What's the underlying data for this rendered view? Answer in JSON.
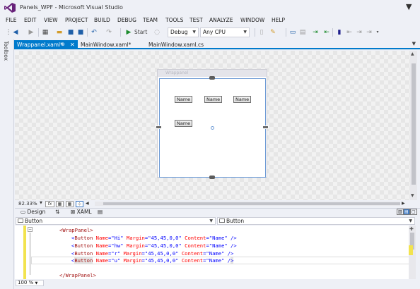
{
  "window": {
    "title": "Panels_WPF - Microsoft Visual Studio",
    "filter_icon": "funnel-icon",
    "logo_color": "#68217a"
  },
  "menu": [
    {
      "label": "FILE"
    },
    {
      "label": "EDIT"
    },
    {
      "label": "VIEW"
    },
    {
      "label": "PROJECT"
    },
    {
      "label": "BUILD"
    },
    {
      "label": "DEBUG"
    },
    {
      "label": "TEAM"
    },
    {
      "label": "TOOLS"
    },
    {
      "label": "TEST"
    },
    {
      "label": "ANALYZE"
    },
    {
      "label": "WINDOW"
    },
    {
      "label": "HELP"
    }
  ],
  "toolbar": {
    "start_label": "Start",
    "configuration": "Debug",
    "platform": "Any CPU",
    "start_color": "#1e8c2e"
  },
  "toolbox": {
    "label": "Toolbox"
  },
  "tabs": [
    {
      "label": "Wrappanel.xaml*",
      "active": true
    },
    {
      "label": "MainWindow.xaml*",
      "active": false
    },
    {
      "label": "MainWindow.xaml.cs",
      "active": false
    }
  ],
  "designer": {
    "window_caption": "Wrappanel",
    "buttons": [
      {
        "label": "Name"
      },
      {
        "label": "Name"
      },
      {
        "label": "Name"
      },
      {
        "label": "Name"
      }
    ]
  },
  "zoom_bar": {
    "zoom": "82.33%",
    "fx_label": "fx"
  },
  "split_tabs": {
    "design": "Design",
    "swap": "⇅",
    "xaml": "XAML"
  },
  "nav": {
    "left": "Button",
    "right": "Button"
  },
  "code": {
    "open_tag": "<WrapPanel>",
    "close_tag": "</WrapPanel>",
    "lines": [
      {
        "el": "Button",
        "name": "Hi"
      },
      {
        "el": "Button",
        "name": "hw"
      },
      {
        "el": "Button",
        "name": "r"
      },
      {
        "el": "Button",
        "name": "u"
      }
    ],
    "margin": "45,45,0,0",
    "content": "Name"
  },
  "editor": {
    "zoom": "100 %"
  },
  "colors": {
    "accent": "#007acc",
    "tag": "#a31515",
    "attr": "#ff0000",
    "value": "#0000ff"
  }
}
